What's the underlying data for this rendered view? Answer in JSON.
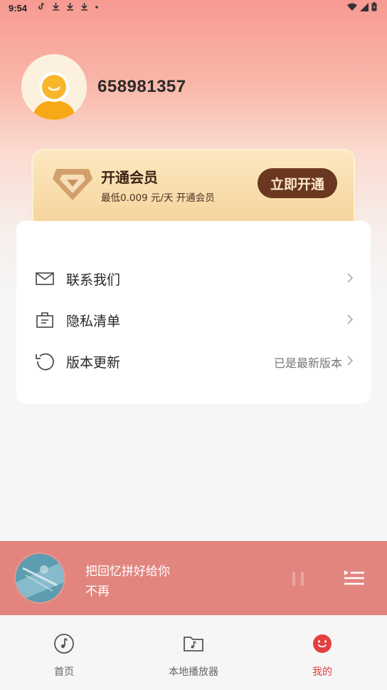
{
  "status_bar": {
    "time": "9:54"
  },
  "profile": {
    "username": "658981357"
  },
  "vip": {
    "title": "开通会员",
    "subtitle": "最低0.009 元/天  开通会员",
    "button_label": "立即开通"
  },
  "menu": {
    "items": [
      {
        "label": "联系我们",
        "value": "",
        "icon": "mail-icon"
      },
      {
        "label": "隐私清单",
        "value": "",
        "icon": "clipboard-icon"
      },
      {
        "label": "版本更新",
        "value": "已是最新版本",
        "icon": "refresh-icon"
      }
    ]
  },
  "player": {
    "title": "把回忆拼好给你",
    "artist": "不再"
  },
  "bottom_nav": {
    "items": [
      {
        "label": "首页",
        "icon": "music-note-icon",
        "active": false
      },
      {
        "label": "本地播放器",
        "icon": "music-folder-icon",
        "active": false
      },
      {
        "label": "我的",
        "icon": "smile-face-icon",
        "active": true
      }
    ]
  },
  "colors": {
    "player_bg": "#e2857f",
    "accent": "#e34141",
    "vip_button": "#6a3820"
  }
}
